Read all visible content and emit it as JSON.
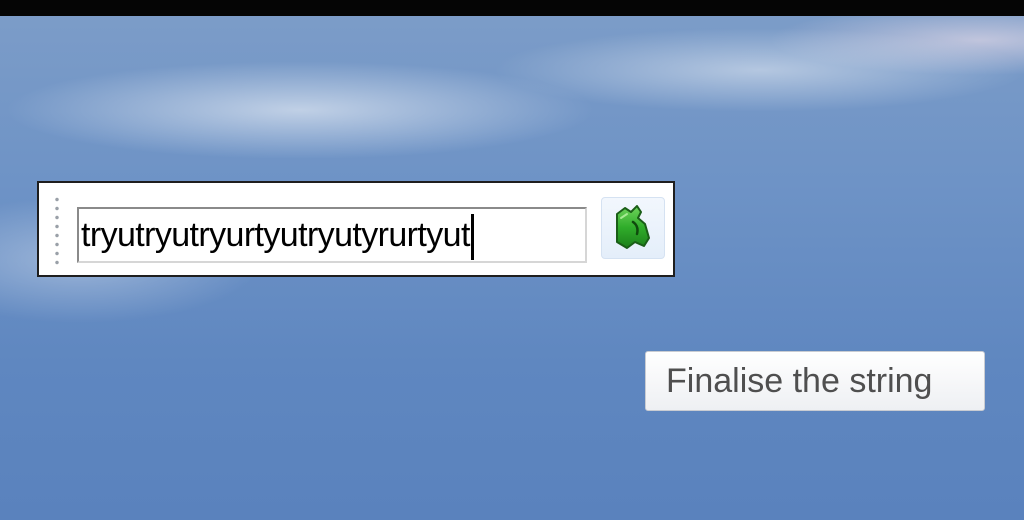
{
  "toolbar": {
    "input_value": "tryutryutryurtyutryutyrurtyut",
    "finalise_icon": "green-glove-icon"
  },
  "tooltip": {
    "text": "Finalise the string"
  },
  "colors": {
    "icon_green": "#2fae2a",
    "top_bar": "#050505"
  }
}
